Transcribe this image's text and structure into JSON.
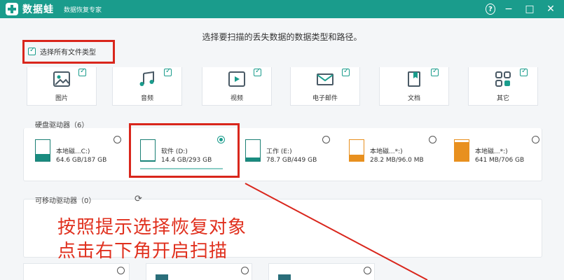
{
  "titlebar": {
    "app_name": "数据蛙",
    "subtitle": "数据恢复专家",
    "help_icon": "?",
    "minimize_icon": "−",
    "maximize_icon": "□",
    "close_icon": "✕"
  },
  "instruction": "选择要扫描的丢失数据的数据类型和路径。",
  "select_all": {
    "label": "选择所有文件类型",
    "checked": true
  },
  "file_types": [
    {
      "label": "图片",
      "icon": "image-icon",
      "checked": true
    },
    {
      "label": "音频",
      "icon": "audio-icon",
      "checked": true
    },
    {
      "label": "视频",
      "icon": "video-icon",
      "checked": true
    },
    {
      "label": "电子邮件",
      "icon": "email-icon",
      "checked": true
    },
    {
      "label": "文档",
      "icon": "document-icon",
      "checked": true
    },
    {
      "label": "其它",
      "icon": "other-icon",
      "checked": true
    }
  ],
  "hard_drives": {
    "title": "硬盘驱动器（6）",
    "drives": [
      {
        "name": "本地磁...C:)",
        "size": "64.6 GB/187 GB",
        "usage": 0.35,
        "selected": false
      },
      {
        "name": "软件 (D:)",
        "size": "14.4 GB/293 GB",
        "usage": 0.05,
        "selected": true
      },
      {
        "name": "工作 (E:)",
        "size": "78.7 GB/449 GB",
        "usage": 0.18,
        "selected": false
      },
      {
        "name": "本地磁...*:)",
        "size": "28.2 MB/96.0 MB",
        "usage": 0.29,
        "selected": false
      },
      {
        "name": "本地磁...*:)",
        "size": "641 MB/706 GB",
        "usage": 0.91,
        "selected": false
      }
    ]
  },
  "removable": {
    "title": "可移动驱动器（0）"
  },
  "annotation": {
    "line1": "按照提示选择恢复对象",
    "line2": "点击右下角开启扫描"
  },
  "colors": {
    "accent": "#1a9c8c",
    "highlight": "#d9261c",
    "annotation": "#e0301e",
    "orange": "#e8901f"
  }
}
